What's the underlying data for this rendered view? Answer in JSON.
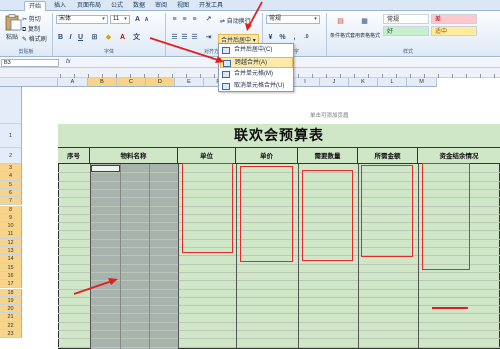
{
  "ribbon_tabs": [
    "开始",
    "插入",
    "页面布局",
    "公式",
    "数据",
    "审阅",
    "视图",
    "开发工具"
  ],
  "clipboard": {
    "paste": "粘贴",
    "cut": "剪切",
    "copy": "复制",
    "format_painter": "格式刷",
    "group": "剪贴板"
  },
  "font": {
    "name": "宋体",
    "size": "11",
    "group": "字体",
    "bold": "B",
    "italic": "I",
    "underline": "U",
    "grow": "A",
    "shrink": "A"
  },
  "alignment": {
    "wrap": "自动换行",
    "merge_center": "合并后居中",
    "group": "对齐方式"
  },
  "number": {
    "format": "常规",
    "group": "数字",
    "percent": "%",
    "comma": ",",
    "currency": "¥"
  },
  "styles": {
    "cond_format": "条件格式",
    "table_format": "套用表格格式",
    "cells": [
      {
        "label": "常规",
        "bg": "#ffffff"
      },
      {
        "label": "差",
        "bg": "#ffc7ce"
      },
      {
        "label": "好",
        "bg": "#c6efce"
      },
      {
        "label": "适中",
        "bg": "#ffeb9c"
      }
    ],
    "group": "样式"
  },
  "formula_bar": {
    "cell_ref": "B3",
    "fx": "fx"
  },
  "merge_menu": {
    "items": [
      "合并后居中(C)",
      "跨越合并(A)",
      "合并单元格(M)",
      "取消单元格合并(U)"
    ],
    "highlighted_index": 1
  },
  "columns": [
    "A",
    "B",
    "C",
    "D",
    "E",
    "F",
    "G",
    "H",
    "I",
    "J",
    "K",
    "L",
    "M"
  ],
  "selected_columns": [
    "B",
    "C",
    "D"
  ],
  "rows": [
    "1",
    "2",
    "3",
    "4",
    "5",
    "6",
    "7",
    "8",
    "9",
    "10",
    "11",
    "12",
    "13",
    "14",
    "15",
    "16",
    "17",
    "18",
    "19",
    "20",
    "21",
    "22",
    "23"
  ],
  "page_header_hint": "单击可添加页眉",
  "sheet": {
    "title": "联欢会预算表",
    "headers": [
      "序号",
      "物料名称",
      "单位",
      "单价",
      "需要数量",
      "所需金额",
      "资金结余情况"
    ]
  },
  "colors": {
    "accent_red": "#e02020",
    "table_green": "#cfe7c6",
    "selection_gray": "#a8b3ae"
  }
}
